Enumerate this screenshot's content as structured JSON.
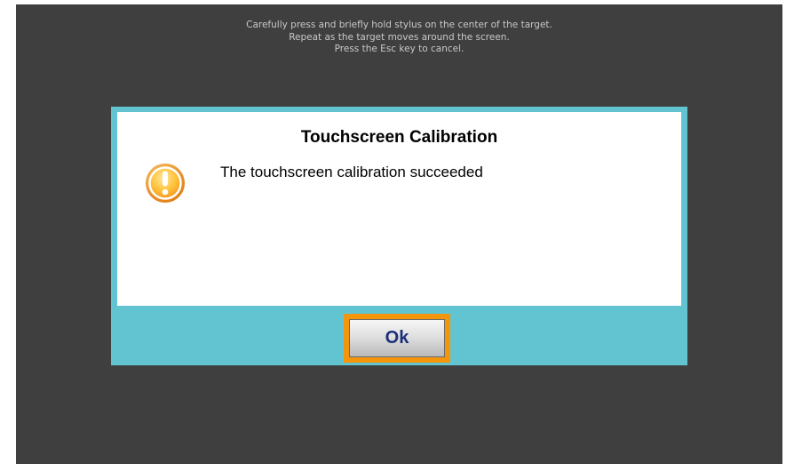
{
  "instructions": {
    "line1": "Carefully press and briefly hold stylus on the center of the target.",
    "line2": "Repeat as the target moves around the screen.",
    "line3": "Press the Esc key to cancel."
  },
  "dialog": {
    "title": "Touchscreen Calibration",
    "message": "The touchscreen calibration succeeded",
    "icon": "warning-exclamation-icon",
    "ok_label": "Ok"
  },
  "colors": {
    "background": "#3f3f3f",
    "dialog_frame": "#63c4d1",
    "focus_highlight": "#f5950b",
    "icon_orange": "#f29a1f",
    "button_text": "#1b2f7a"
  }
}
